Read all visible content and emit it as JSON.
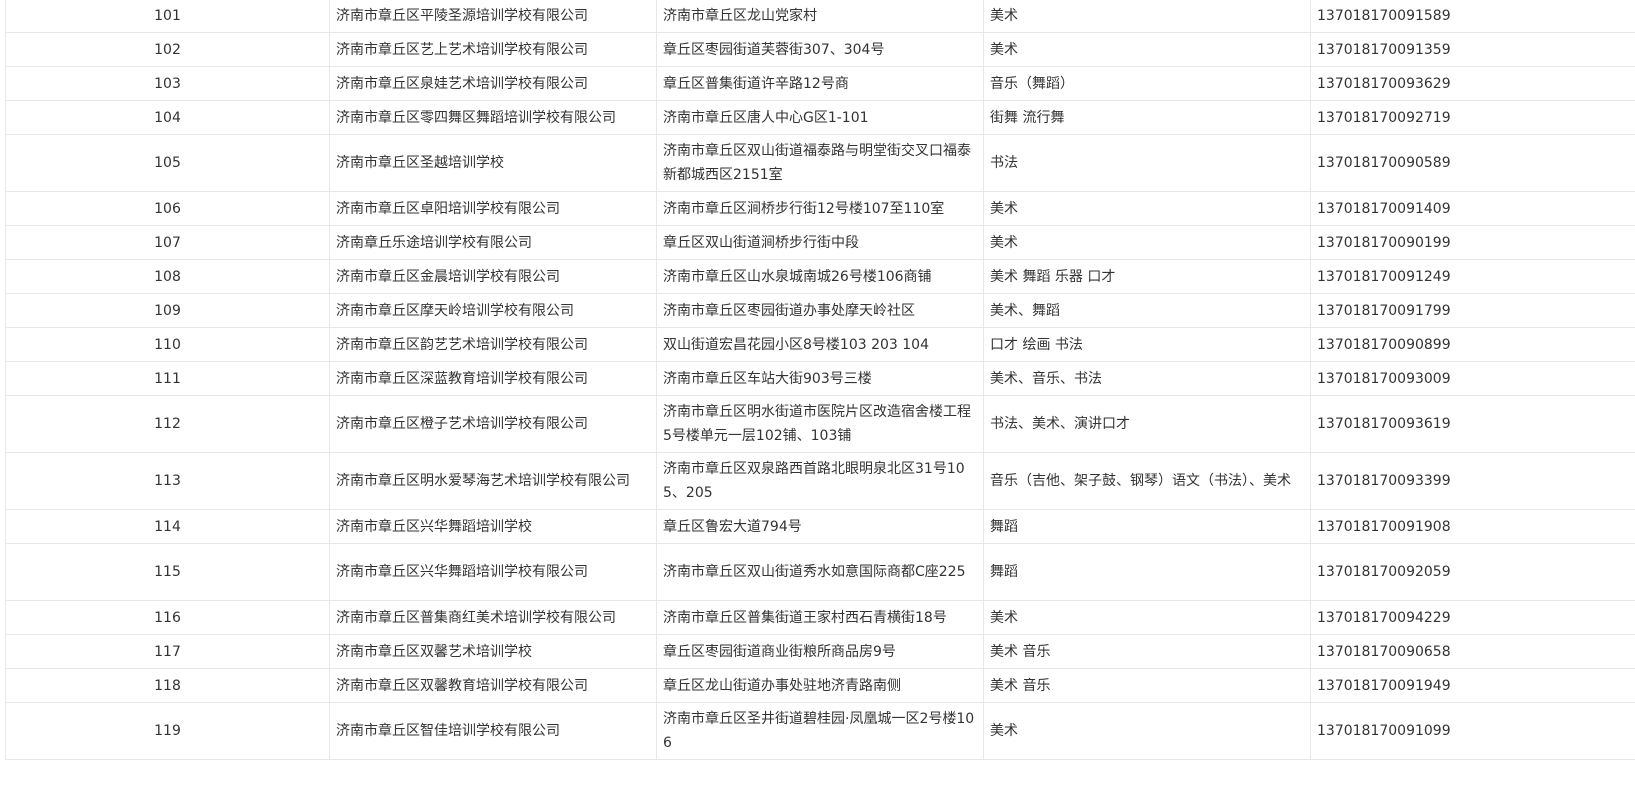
{
  "rows": [
    {
      "index": "101",
      "name": "济南市章丘区平陵圣源培训学校有限公司",
      "address": "济南市章丘区龙山党家村",
      "category": "美术",
      "license": "137018170091589"
    },
    {
      "index": "102",
      "name": "济南市章丘区艺上艺术培训学校有限公司",
      "address": "章丘区枣园街道芙蓉街307、304号",
      "category": "美术",
      "license": "137018170091359"
    },
    {
      "index": "103",
      "name": "济南市章丘区泉娃艺术培训学校有限公司",
      "address": "章丘区普集街道许辛路12号商",
      "category": "音乐（舞蹈）",
      "license": "137018170093629"
    },
    {
      "index": "104",
      "name": "济南市章丘区零四舞区舞蹈培训学校有限公司",
      "address": "济南市章丘区唐人中心G区1-101",
      "category": "街舞 流行舞",
      "license": "137018170092719"
    },
    {
      "index": "105",
      "name": "济南市章丘区圣越培训学校",
      "address": "济南市章丘区双山街道福泰路与明堂街交叉口福泰新都城西区2151室",
      "category": "书法",
      "license": "137018170090589"
    },
    {
      "index": "106",
      "name": "济南市章丘区卓阳培训学校有限公司",
      "address": "济南市章丘区涧桥步行街12号楼107至110室",
      "category": "美术",
      "license": "137018170091409"
    },
    {
      "index": "107",
      "name": "济南章丘乐途培训学校有限公司",
      "address": "章丘区双山街道涧桥步行街中段",
      "category": "美术",
      "license": "137018170090199"
    },
    {
      "index": "108",
      "name": "济南市章丘区金晨培训学校有限公司",
      "address": "济南市章丘区山水泉城南城26号楼106商铺",
      "category": "美术 舞蹈 乐器 口才",
      "license": "137018170091249"
    },
    {
      "index": "109",
      "name": "济南市章丘区摩天岭培训学校有限公司",
      "address": "济南市章丘区枣园街道办事处摩天岭社区",
      "category": "美术、舞蹈",
      "license": "137018170091799"
    },
    {
      "index": "110",
      "name": "济南市章丘区韵艺艺术培训学校有限公司",
      "address": "双山街道宏昌花园小区8号楼103 203 104",
      "category": "口才  绘画  书法",
      "license": "137018170090899"
    },
    {
      "index": "111",
      "name": "济南市章丘区深蓝教育培训学校有限公司",
      "address": "济南市章丘区车站大街903号三楼",
      "category": "美术、音乐、书法",
      "license": "137018170093009"
    },
    {
      "index": "112",
      "name": "济南市章丘区橙子艺术培训学校有限公司",
      "address": "济南市章丘区明水街道市医院片区改造宿舍楼工程5号楼单元一层102铺、103铺",
      "category": "书法、美术、演讲口才",
      "license": "137018170093619"
    },
    {
      "index": "113",
      "name": "济南市章丘区明水爱琴海艺术培训学校有限公司",
      "address": "济南市章丘区双泉路西首路北眼明泉北区31号105、205",
      "category": "音乐（吉他、架子鼓、钢琴）语文（书法）、美术",
      "license": "137018170093399"
    },
    {
      "index": "114",
      "name": "济南市章丘区兴华舞蹈培训学校",
      "address": "章丘区鲁宏大道794号",
      "category": "舞蹈",
      "license": "137018170091908"
    },
    {
      "index": "115",
      "name": "济南市章丘区兴华舞蹈培训学校有限公司",
      "address": "济南市章丘区双山街道秀水如意国际商都C座225",
      "category": "舞蹈",
      "license": "137018170092059"
    },
    {
      "index": "116",
      "name": "济南市章丘区普集商红美术培训学校有限公司",
      "address": "济南市章丘区普集街道王家村西石青横街18号",
      "category": "美术",
      "license": "137018170094229"
    },
    {
      "index": "117",
      "name": "济南市章丘区双馨艺术培训学校",
      "address": "章丘区枣园街道商业街粮所商品房9号",
      "category": "美术 音乐",
      "license": "137018170090658"
    },
    {
      "index": "118",
      "name": "济南市章丘区双馨教育培训学校有限公司",
      "address": "章丘区龙山街道办事处驻地济青路南侧",
      "category": "美术 音乐",
      "license": "137018170091949"
    },
    {
      "index": "119",
      "name": "济南市章丘区智佳培训学校有限公司",
      "address": "济南市章丘区圣井街道碧桂园·凤凰城一区2号楼106",
      "category": "美术",
      "license": "137018170091099"
    }
  ]
}
